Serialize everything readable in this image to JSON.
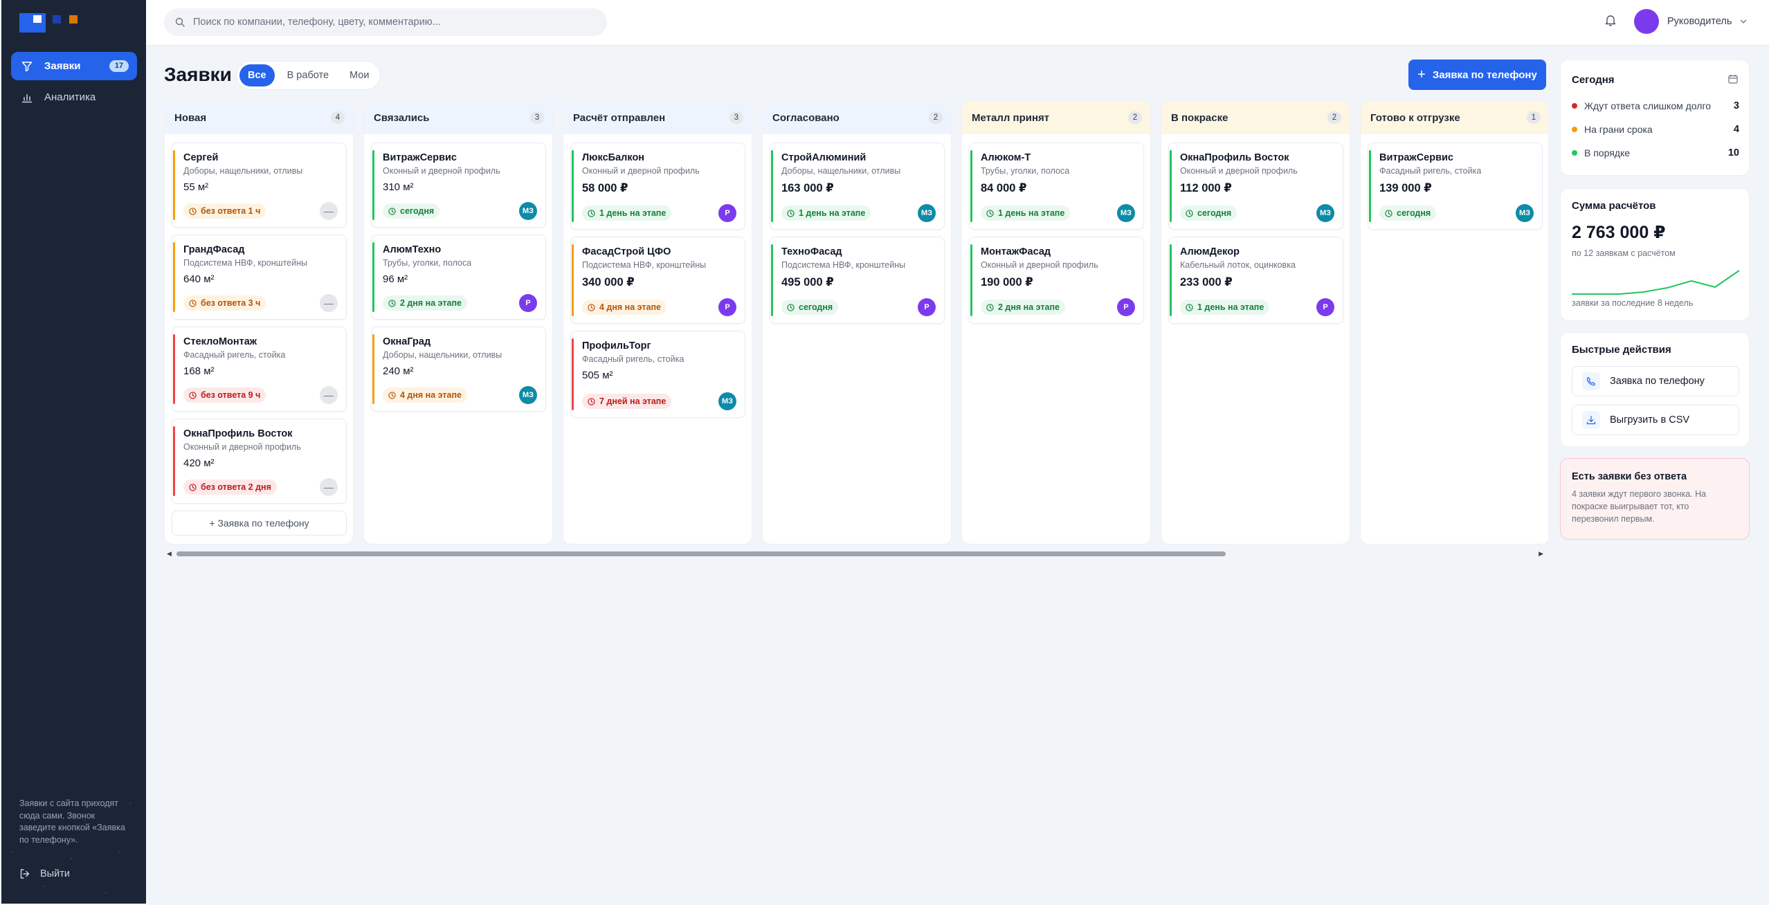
{
  "sidebar": {
    "nav": [
      {
        "label": "Заявки",
        "badge": "17",
        "active": true
      },
      {
        "label": "Аналитика",
        "active": false
      }
    ],
    "note": "Заявки с сайта приходят сюда сами. Звонок заведите кнопкой «Заявка по телефону».",
    "logout_label": "Выйти"
  },
  "header": {
    "search_placeholder": "Поиск по компании, телефону, цвету, комментарию...",
    "user_name": "Руководитель"
  },
  "main": {
    "title": "Заявки",
    "filters": [
      "Все",
      "В работе",
      "Мои"
    ],
    "add_button_label": "Заявка по телефону"
  },
  "board": {
    "columns": [
      {
        "title": "Новая",
        "count": "4",
        "cards": [
          {
            "name": "Сергей",
            "sub": "Доборы, нащельники, отливы",
            "value": "55 м²",
            "status": "без ответа 1 ч"
          },
          {
            "name": "ГрандФасад",
            "sub": "Подсистема НВФ, кронштейны",
            "value": "640 м²",
            "status": "без ответа 3 ч"
          },
          {
            "name": "СтеклоМонтаж",
            "sub": "Фасадный ригель, стойка",
            "value": "168 м²",
            "status": "без ответа 9 ч"
          },
          {
            "name": "ОкнаПрофиль Восток",
            "sub": "Оконный и дверной профиль",
            "value": "420 м²",
            "status": "без ответа 2 дня"
          }
        ],
        "add_label": "+ Заявка по телефону"
      },
      {
        "title": "Связались",
        "count": "3",
        "cards": [
          {
            "name": "ВитражСервис",
            "sub": "Оконный и дверной профиль",
            "value": "310 м²",
            "status": "сегодня",
            "avatar": "МЗ"
          },
          {
            "name": "АлюмТехно",
            "sub": "Трубы, уголки, полоса",
            "value": "96 м²",
            "status": "2 дня на этапе",
            "avatar": "Р"
          },
          {
            "name": "ОкнаГрад",
            "sub": "Доборы, нащельники, отливы",
            "value": "240 м²",
            "status": "4 дня на этапе",
            "avatar": "МЗ"
          }
        ]
      },
      {
        "title": "Расчёт отправлен",
        "count": "3",
        "cards": [
          {
            "name": "ЛюксБалкон",
            "sub": "Оконный и дверной профиль",
            "value": "58 000 ₽",
            "status": "1 день на этапе",
            "avatar": "Р"
          },
          {
            "name": "ФасадСтрой ЦФО",
            "sub": "Подсистема НВФ, кронштейны",
            "value": "340 000 ₽",
            "status": "4 дня на этапе",
            "avatar": "Р"
          },
          {
            "name": "ПрофильТорг",
            "sub": "Фасадный ригель, стойка",
            "value": "505 м²",
            "status": "7 дней на этапе",
            "avatar": "МЗ"
          }
        ]
      },
      {
        "title": "Согласовано",
        "count": "2",
        "cards": [
          {
            "name": "СтройАлюминий",
            "sub": "Доборы, нащельники, отливы",
            "value": "163 000 ₽",
            "status": "1 день на этапе",
            "avatar": "МЗ"
          },
          {
            "name": "ТехноФасад",
            "sub": "Подсистема НВФ, кронштейны",
            "value": "495 000 ₽",
            "status": "сегодня",
            "avatar": "Р"
          }
        ]
      },
      {
        "title": "Металл принят",
        "count": "2",
        "cards": [
          {
            "name": "Алюком-Т",
            "sub": "Трубы, уголки, полоса",
            "value": "84 000 ₽",
            "status": "1 день на этапе",
            "avatar": "МЗ"
          },
          {
            "name": "МонтажФасад",
            "sub": "Оконный и дверной профиль",
            "value": "190 000 ₽",
            "status": "2 дня на этапе",
            "avatar": "Р"
          }
        ]
      },
      {
        "title": "В покраске",
        "count": "2",
        "cards": [
          {
            "name": "ОкнаПрофиль Восток",
            "sub": "Оконный и дверной профиль",
            "value": "112 000 ₽",
            "status": "сегодня",
            "avatar": "МЗ"
          },
          {
            "name": "АлюмДекор",
            "sub": "Кабельный лоток, оцинковка",
            "value": "233 000 ₽",
            "status": "1 день на этапе",
            "avatar": "Р"
          }
        ]
      },
      {
        "title": "Готово к отгрузке",
        "count": "1",
        "cards": [
          {
            "name": "ВитражСервис",
            "sub": "Фасадный ригель, стойка",
            "value": "139 000 ₽",
            "status": "сегодня",
            "avatar": "МЗ"
          }
        ]
      }
    ]
  },
  "right": {
    "today": {
      "title": "Сегодня",
      "rows": [
        {
          "label": "Ждут ответа слишком долго",
          "value": "3"
        },
        {
          "label": "На грани срока",
          "value": "4"
        },
        {
          "label": "В порядке",
          "value": "10"
        }
      ]
    },
    "sum": {
      "title": "Сумма расчётов",
      "value": "2 763 000 ₽",
      "sub": "по 12 заявкам с расчётом",
      "caption": "заявки за последние 8 недель"
    },
    "quick": {
      "title": "Быстрые действия",
      "call_label": "Заявка по телефону",
      "csv_label": "Выгрузить в CSV"
    },
    "alert": {
      "title": "Есть заявки без ответа",
      "text": "4 заявки ждут первого звонка. На покраске выигрывает тот, кто перезвонил первым."
    }
  },
  "colors": {
    "accent": "#2563eb",
    "sidebar": "#1c2536",
    "status_red": "#dc2626",
    "status_orange": "#f59e0b",
    "status_green": "#22c55e"
  }
}
